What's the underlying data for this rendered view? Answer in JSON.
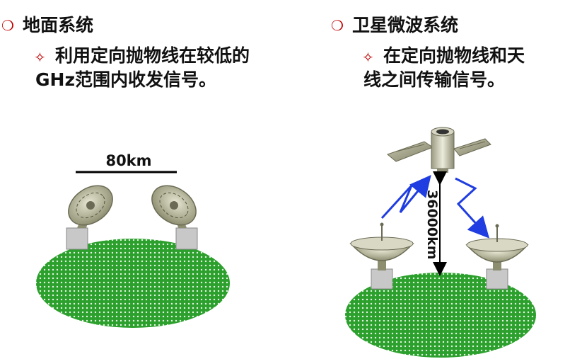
{
  "left": {
    "heading": "地面系统",
    "bullet_line1": "利用定向抛物线在较低的",
    "bullet_line2": "GHz范围内收发信号。",
    "distance_label": "80km"
  },
  "right": {
    "heading": "卫星微波系统",
    "bullet_line1": "在定向抛物线和天",
    "bullet_line2": "线之间传输信号。",
    "altitude_label": "36000km"
  },
  "colors": {
    "bullet_red": "#c00000",
    "ground_green": "#2ca02c",
    "signal_blue": "#1f3de0",
    "dish_olive": "#a9a98b"
  }
}
